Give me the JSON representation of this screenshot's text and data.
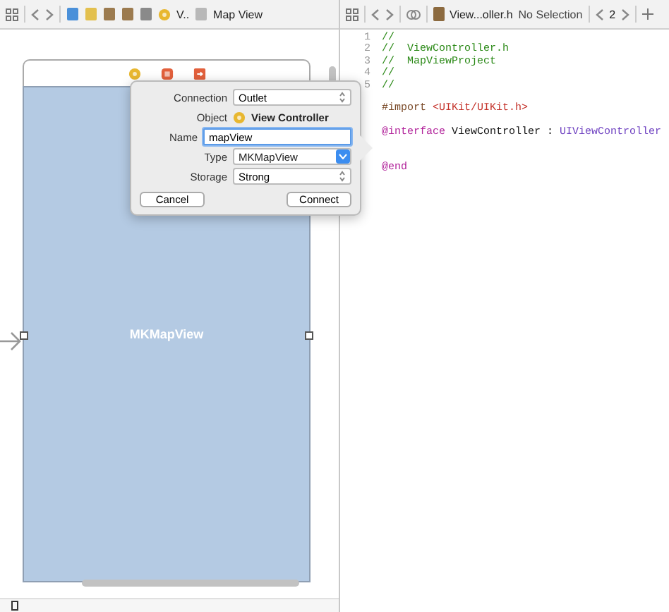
{
  "left_toolbar": {
    "breadcrumb_last": "V..",
    "title": "Map View"
  },
  "right_toolbar": {
    "file": "View...oller.h",
    "selection": "No Selection",
    "counter": "2"
  },
  "scene": {
    "view_label": "MKMapView"
  },
  "popover": {
    "rows": [
      {
        "kind": "select",
        "label": "Connection",
        "value": "Outlet"
      },
      {
        "kind": "object",
        "label": "Object",
        "value": "View Controller"
      },
      {
        "kind": "input",
        "label": "Name",
        "value": "mapView"
      },
      {
        "kind": "combo",
        "label": "Type",
        "value": "MKMapView"
      },
      {
        "kind": "select",
        "label": "Storage",
        "value": "Strong"
      }
    ],
    "buttons": [
      "Cancel",
      "Connect"
    ]
  },
  "code": [
    {
      "number": "1",
      "segments": [
        {
          "kind": "comment",
          "text": "//"
        }
      ]
    },
    {
      "number": "2",
      "segments": [
        {
          "kind": "comment",
          "text": "//  ViewController.h"
        }
      ]
    },
    {
      "number": "3",
      "segments": [
        {
          "kind": "comment",
          "text": "//  MapViewProject"
        }
      ]
    },
    {
      "number": "4",
      "segments": [
        {
          "kind": "comment",
          "text": "//"
        }
      ]
    },
    {
      "number": "5",
      "segments": [
        {
          "kind": "comment",
          "text": "//"
        }
      ]
    },
    {
      "kind": "import",
      "segments": [
        {
          "kind": "directive",
          "text": "#import "
        },
        {
          "kind": "string",
          "text": "<UIKit/UIKit.h>"
        }
      ]
    },
    {
      "kind": "declaration",
      "segments": [
        {
          "kind": "keyword",
          "text": "@interface"
        },
        {
          "kind": "plain",
          "text": " ViewController : "
        },
        {
          "kind": "type",
          "text": "UIViewController"
        }
      ]
    },
    {
      "kind": "end",
      "segments": [
        {
          "kind": "keyword",
          "text": "@end"
        }
      ]
    }
  ]
}
